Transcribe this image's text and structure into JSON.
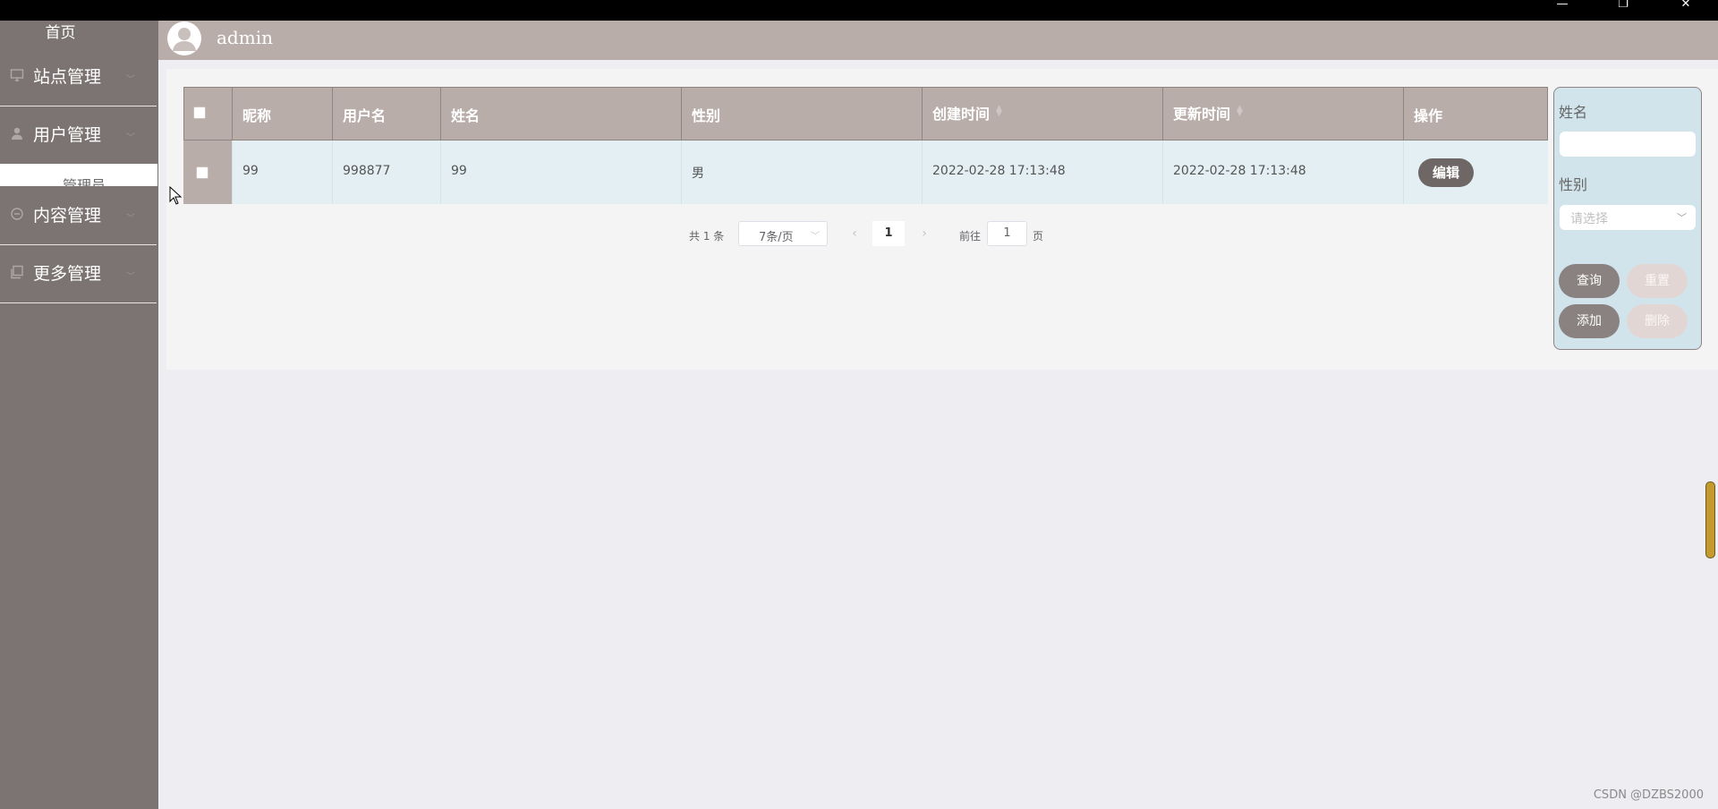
{
  "window": {
    "minimize": "—",
    "restore": "❐",
    "close": "✕"
  },
  "sidebar": {
    "home": "首页",
    "items": [
      {
        "label": "站点管理",
        "icon": "monitor-icon"
      },
      {
        "label": "用户管理",
        "icon": "user-icon"
      },
      {
        "label": "内容管理",
        "icon": "chat-icon"
      },
      {
        "label": "更多管理",
        "icon": "copy-icon"
      }
    ],
    "subitem": "管理员"
  },
  "header": {
    "username": "admin"
  },
  "table": {
    "columns": [
      "昵称",
      "用户名",
      "姓名",
      "性别",
      "创建时间",
      "更新时间",
      "操作"
    ],
    "rows": [
      {
        "nickname": "99",
        "username": "998877",
        "name": "99",
        "gender": "男",
        "created": "2022-02-28 17:13:48",
        "updated": "2022-02-28 17:13:48",
        "action": "编辑"
      }
    ]
  },
  "pagination": {
    "total": "共 1 条",
    "page_size": "7条/页",
    "prev": "‹",
    "current": "1",
    "next": "›",
    "goto_label": "前往",
    "goto_value": "1",
    "goto_unit": "页"
  },
  "search": {
    "name_label": "姓名",
    "name_value": "",
    "gender_label": "性别",
    "gender_placeholder": "请选择",
    "query": "查询",
    "reset": "重置",
    "add": "添加",
    "delete": "删除"
  },
  "watermark": "CSDN @DZBS2000",
  "colors": {
    "sidebar": "#7c7473",
    "header": "#b9adaa",
    "row": "#e3eff2",
    "search_panel": "#d1e4ec",
    "button_dark": "#6e6765"
  }
}
